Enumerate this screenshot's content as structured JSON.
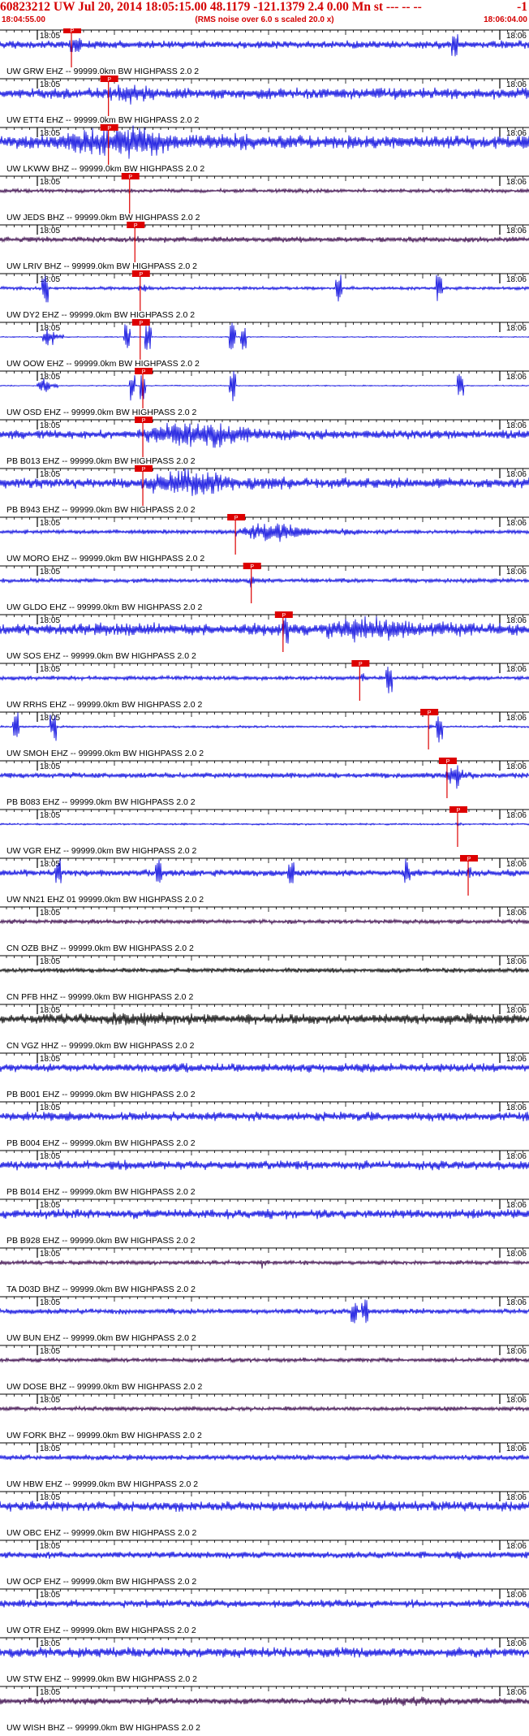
{
  "header": {
    "title": "60823212 UW Jul 20, 2014 18:05:15.00   48.1179 -121.1379  2.4 0.00 Mn st --- -- --",
    "title_right": "-1",
    "start_time": "18:04:55.00",
    "rms_note": "(RMS noise over 6.0 s scaled 20.0 x)",
    "end_time": "18:06:04.00"
  },
  "chart_data": {
    "type": "line",
    "minute_labels": [
      "18:05",
      "18:06"
    ],
    "pick_label": "P",
    "colors": {
      "blue": "#0000dd",
      "black": "#000000",
      "purple": "#330044",
      "pick": "#dd0000",
      "grid": "#000000"
    },
    "traces": [
      {
        "label": "UW GRW EHZ -- 99999.0km BW  HIGHPASS  2.0  2",
        "color": "blue",
        "amp": 0.35,
        "pick": 0.135,
        "event_start": 0.13,
        "event_end": 0.17,
        "event_gain": 3.0,
        "spikes": [
          0.86
        ],
        "seed": 11
      },
      {
        "label": "UW ETT4 EHZ -- 99999.0km BW  HIGHPASS  2.0  2",
        "color": "blue",
        "amp": 0.5,
        "pick": 0.205,
        "event_start": 0.19,
        "event_end": 0.35,
        "event_gain": 1.8,
        "spikes": [],
        "seed": 12
      },
      {
        "label": "UW LKWW BHZ -- 99999.0km BW  HIGHPASS  2.0  2",
        "color": "blue",
        "amp": 0.6,
        "pick": 0.205,
        "event_start": 0.1,
        "event_end": 0.48,
        "event_gain": 2.4,
        "spikes": [],
        "seed": 13
      },
      {
        "label": "UW JEDS BHZ -- 99999.0km BW  HIGHPASS  2.0  2",
        "color": "purple",
        "amp": 0.18,
        "pick": 0.245,
        "event_start": 0.24,
        "event_end": 0.27,
        "event_gain": 1.2,
        "spikes": [],
        "seed": 14
      },
      {
        "label": "UW LRIV BHZ -- 99999.0km BW  HIGHPASS  2.0  2",
        "color": "purple",
        "amp": 0.25,
        "pick": 0.255,
        "event_start": 0.25,
        "event_end": 0.28,
        "event_gain": 1.3,
        "spikes": [],
        "seed": 15
      },
      {
        "label": "UW DY2 EHZ -- 99999.0km BW  HIGHPASS  2.0  2",
        "color": "blue",
        "amp": 0.15,
        "pick": 0.265,
        "event_start": 0.26,
        "event_end": 0.29,
        "event_gain": 3.0,
        "spikes": [
          0.085,
          0.64,
          0.83
        ],
        "seed": 16
      },
      {
        "label": "UW OOW EHZ -- 99999.0km BW  HIGHPASS  2.0  2",
        "color": "blue",
        "amp": 0.05,
        "pick": 0.265,
        "event_start": 0.08,
        "event_end": 0.12,
        "event_gain": 25.0,
        "spikes": [
          0.24,
          0.28,
          0.44,
          0.46
        ],
        "seed": 17
      },
      {
        "label": "UW OSD EHZ -- 99999.0km BW  HIGHPASS  2.0  2",
        "color": "blue",
        "amp": 0.05,
        "pick": 0.27,
        "event_start": 0.07,
        "event_end": 0.11,
        "event_gain": 18.0,
        "spikes": [
          0.25,
          0.27,
          0.44,
          0.87
        ],
        "seed": 18
      },
      {
        "label": "PB B013 EHZ -- 99999.0km BW  HIGHPASS  2.0  2",
        "color": "blue",
        "amp": 0.4,
        "pick": 0.27,
        "event_start": 0.26,
        "event_end": 0.62,
        "event_gain": 3.0,
        "spikes": [],
        "seed": 19
      },
      {
        "label": "PB B943 EHZ -- 99999.0km BW  HIGHPASS  2.0  2",
        "color": "blue",
        "amp": 0.45,
        "pick": 0.27,
        "event_start": 0.26,
        "event_end": 0.55,
        "event_gain": 2.8,
        "spikes": [],
        "seed": 20
      },
      {
        "label": "UW MORO EHZ -- 99999.0km BW  HIGHPASS  2.0  2",
        "color": "blue",
        "amp": 0.2,
        "pick": 0.445,
        "event_start": 0.44,
        "event_end": 0.68,
        "event_gain": 4.5,
        "spikes": [],
        "seed": 21
      },
      {
        "label": "UW GLDO EHZ -- 99999.0km BW  HIGHPASS  2.0  2",
        "color": "blue",
        "amp": 0.2,
        "pick": 0.475,
        "event_start": 0.47,
        "event_end": 0.49,
        "event_gain": 4.0,
        "spikes": [],
        "seed": 22
      },
      {
        "label": "UW SOS EHZ -- 99999.0km BW  HIGHPASS  2.0  2",
        "color": "blue",
        "amp": 0.55,
        "pick": 0.535,
        "event_start": 0.6,
        "event_end": 0.9,
        "event_gain": 2.0,
        "spikes": [
          0.54
        ],
        "seed": 23
      },
      {
        "label": "UW RRHS EHZ -- 99999.0km BW  HIGHPASS  2.0  2",
        "color": "blue",
        "amp": 0.2,
        "pick": 0.68,
        "event_start": 0.68,
        "event_end": 0.7,
        "event_gain": 3.0,
        "spikes": [
          0.735
        ],
        "seed": 24
      },
      {
        "label": "UW SMOH EHZ -- 99999.0km BW  HIGHPASS  2.0  2",
        "color": "blue",
        "amp": 0.1,
        "pick": 0.81,
        "event_start": 0.81,
        "event_end": 0.82,
        "event_gain": 4.0,
        "spikes": [
          0.03,
          0.1,
          0.83
        ],
        "seed": 25
      },
      {
        "label": "PB B083 EHZ -- 99999.0km BW  HIGHPASS  2.0  2",
        "color": "blue",
        "amp": 0.25,
        "pick": 0.845,
        "event_start": 0.84,
        "event_end": 0.9,
        "event_gain": 5.0,
        "spikes": [],
        "seed": 26
      },
      {
        "label": "UW VGR EHZ -- 99999.0km BW  HIGHPASS  2.0  2",
        "color": "blue",
        "amp": 0.08,
        "pick": 0.865,
        "event_start": 0.86,
        "event_end": 0.88,
        "event_gain": 3.0,
        "spikes": [],
        "seed": 27
      },
      {
        "label": "UW NN21 EHZ 01 99999.0km BW  HIGHPASS  2.0  2",
        "color": "blue",
        "amp": 0.3,
        "pick": 0.885,
        "event_start": 0.88,
        "event_end": 0.9,
        "event_gain": 2.5,
        "spikes": [
          0.11,
          0.3,
          0.55,
          0.77
        ],
        "seed": 28
      },
      {
        "label": "CN OZB BHZ -- 99999.0km BW  HIGHPASS  2.0  2",
        "color": "purple",
        "amp": 0.2,
        "pick": null,
        "event_start": 0,
        "event_end": 0,
        "event_gain": 1,
        "spikes": [],
        "seed": 29
      },
      {
        "label": "CN PFB HHZ -- 99999.0km BW  HIGHPASS  2.0  2",
        "color": "black",
        "amp": 0.22,
        "pick": null,
        "event_start": 0,
        "event_end": 0,
        "event_gain": 1,
        "spikes": [],
        "seed": 30
      },
      {
        "label": "CN VGZ HHZ -- 99999.0km BW  HIGHPASS  2.0  2",
        "color": "black",
        "amp": 0.45,
        "pick": null,
        "event_start": 0.2,
        "event_end": 0.4,
        "event_gain": 1.4,
        "spikes": [],
        "seed": 31
      },
      {
        "label": "PB B001 EHZ -- 99999.0km BW  HIGHPASS  2.0  2",
        "color": "blue",
        "amp": 0.4,
        "pick": null,
        "event_start": 0,
        "event_end": 0,
        "event_gain": 1,
        "spikes": [],
        "seed": 32
      },
      {
        "label": "PB B004 EHZ -- 99999.0km BW  HIGHPASS  2.0  2",
        "color": "blue",
        "amp": 0.4,
        "pick": null,
        "event_start": 0,
        "event_end": 0,
        "event_gain": 1,
        "spikes": [],
        "seed": 33
      },
      {
        "label": "PB B014 EHZ -- 99999.0km BW  HIGHPASS  2.0  2",
        "color": "blue",
        "amp": 0.42,
        "pick": null,
        "event_start": 0,
        "event_end": 0,
        "event_gain": 1,
        "spikes": [],
        "seed": 34
      },
      {
        "label": "PB B928 EHZ -- 99999.0km BW  HIGHPASS  2.0  2",
        "color": "blue",
        "amp": 0.42,
        "pick": null,
        "event_start": 0,
        "event_end": 0,
        "event_gain": 1,
        "spikes": [],
        "seed": 35
      },
      {
        "label": "TA D03D BHZ -- 99999.0km BW  HIGHPASS  2.0  2",
        "color": "purple",
        "amp": 0.2,
        "pick": null,
        "event_start": 0.49,
        "event_end": 0.51,
        "event_gain": 2.5,
        "spikes": [],
        "seed": 36
      },
      {
        "label": "UW BUN EHZ -- 99999.0km BW  HIGHPASS  2.0  2",
        "color": "blue",
        "amp": 0.25,
        "pick": null,
        "event_start": 0,
        "event_end": 0,
        "event_gain": 1,
        "spikes": [
          0.67,
          0.69
        ],
        "seed": 37
      },
      {
        "label": "UW DOSE BHZ -- 99999.0km BW  HIGHPASS  2.0  2",
        "color": "purple",
        "amp": 0.2,
        "pick": null,
        "event_start": 0,
        "event_end": 0,
        "event_gain": 1,
        "spikes": [],
        "seed": 38
      },
      {
        "label": "UW FORK BHZ -- 99999.0km BW  HIGHPASS  2.0  2",
        "color": "purple",
        "amp": 0.2,
        "pick": null,
        "event_start": 0.72,
        "event_end": 0.74,
        "event_gain": 1.5,
        "spikes": [],
        "seed": 39
      },
      {
        "label": "UW HBW EHZ -- 99999.0km BW  HIGHPASS  2.0  2",
        "color": "blue",
        "amp": 0.25,
        "pick": null,
        "event_start": 0,
        "event_end": 0,
        "event_gain": 1,
        "spikes": [],
        "seed": 40
      },
      {
        "label": "UW OBC EHZ -- 99999.0km BW  HIGHPASS  2.0  2",
        "color": "blue",
        "amp": 0.45,
        "pick": null,
        "event_start": 0,
        "event_end": 0,
        "event_gain": 1,
        "spikes": [],
        "seed": 41
      },
      {
        "label": "UW OCP EHZ -- 99999.0km BW  HIGHPASS  2.0  2",
        "color": "blue",
        "amp": 0.32,
        "pick": null,
        "event_start": 0.86,
        "event_end": 0.88,
        "event_gain": 1.6,
        "spikes": [],
        "seed": 42
      },
      {
        "label": "UW OTR EHZ -- 99999.0km BW  HIGHPASS  2.0  2",
        "color": "blue",
        "amp": 0.35,
        "pick": null,
        "event_start": 0,
        "event_end": 0,
        "event_gain": 1,
        "spikes": [],
        "seed": 43
      },
      {
        "label": "UW STW EHZ -- 99999.0km BW  HIGHPASS  2.0  2",
        "color": "blue",
        "amp": 0.45,
        "pick": null,
        "event_start": 0,
        "event_end": 0,
        "event_gain": 1,
        "spikes": [],
        "seed": 44
      },
      {
        "label": "UW WISH BHZ -- 99999.0km BW  HIGHPASS  2.0  2",
        "color": "purple",
        "amp": 0.3,
        "pick": null,
        "event_start": 0.7,
        "event_end": 0.95,
        "event_gain": 1.5,
        "spikes": [],
        "seed": 45
      }
    ]
  }
}
